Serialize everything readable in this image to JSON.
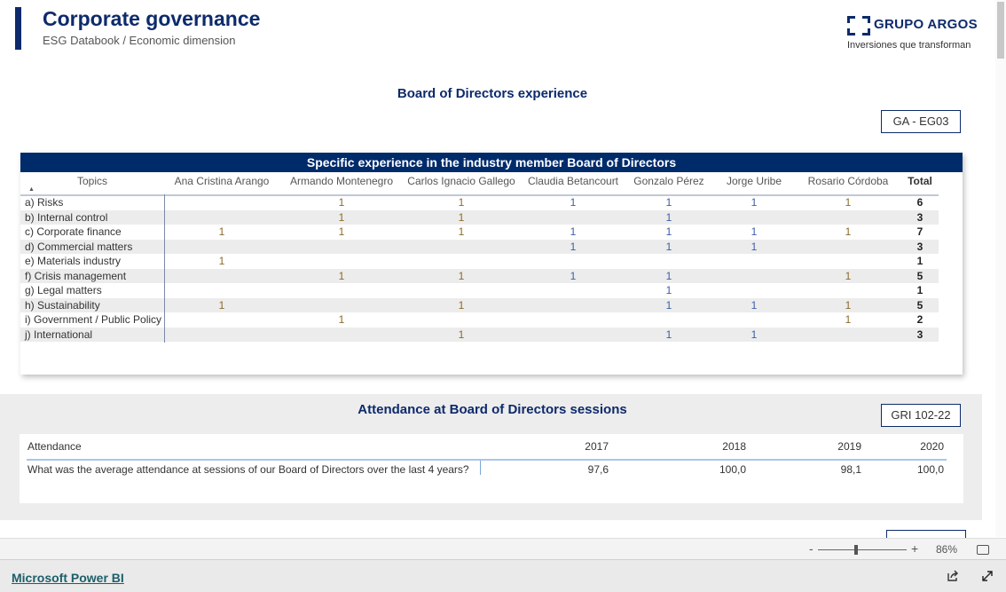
{
  "header": {
    "title": "Corporate governance",
    "subtitle": "ESG Databook / Economic dimension",
    "logo_brand": "GRUPO ARGOS",
    "logo_tagline": "Inversiones que transforman"
  },
  "colors": {
    "navy": "#0d2a6b",
    "table_header": "#002b6b",
    "value_gold": "#8a6a2a",
    "value_blue": "#3a5ea8"
  },
  "experience": {
    "heading": "Board of Directors experience",
    "code": "GA - EG03",
    "table_title": "Specific experience in the industry member Board of Directors",
    "topics_header": "Topics",
    "total_header": "Total",
    "members": [
      "Ana Cristina Arango",
      "Armando Montenegro",
      "Carlos Ignacio Gallego",
      "Claudia Betancourt",
      "Gonzalo Pérez",
      "Jorge Uribe",
      "Rosario Córdoba"
    ],
    "rows": [
      {
        "topic": "a) Risks",
        "values": [
          "",
          "1",
          "1",
          "1",
          "1",
          "1",
          "1"
        ],
        "total": "6"
      },
      {
        "topic": "b) Internal control",
        "values": [
          "",
          "1",
          "1",
          "",
          "1",
          "",
          ""
        ],
        "total": "3"
      },
      {
        "topic": "c) Corporate finance",
        "values": [
          "1",
          "1",
          "1",
          "1",
          "1",
          "1",
          "1"
        ],
        "total": "7"
      },
      {
        "topic": "d) Commercial matters",
        "values": [
          "",
          "",
          "",
          "1",
          "1",
          "1",
          ""
        ],
        "total": "3"
      },
      {
        "topic": "e) Materials industry",
        "values": [
          "1",
          "",
          "",
          "",
          "",
          "",
          ""
        ],
        "total": "1"
      },
      {
        "topic": "f) Crisis management",
        "values": [
          "",
          "1",
          "1",
          "1",
          "1",
          "",
          "1"
        ],
        "total": "5"
      },
      {
        "topic": "g) Legal matters",
        "values": [
          "",
          "",
          "",
          "",
          "1",
          "",
          ""
        ],
        "total": "1"
      },
      {
        "topic": "h) Sustainability",
        "values": [
          "1",
          "",
          "1",
          "",
          "1",
          "1",
          "1"
        ],
        "total": "5"
      },
      {
        "topic": "i) Government / Public Policy",
        "values": [
          "",
          "1",
          "",
          "",
          "",
          "",
          "1"
        ],
        "total": "2"
      },
      {
        "topic": "j) International",
        "values": [
          "",
          "",
          "1",
          "",
          "1",
          "1",
          ""
        ],
        "total": "3"
      }
    ]
  },
  "attendance": {
    "heading": "Attendance at Board of Directors sessions",
    "code": "GRI 102-22",
    "label_header": "Attendance",
    "years": [
      "2017",
      "2018",
      "2019",
      "2020"
    ],
    "question": "What was the average attendance at sessions of our Board of Directors over the last 4 years?",
    "values": [
      "97,6",
      "100,0",
      "98,1",
      "100,0"
    ]
  },
  "zoom": {
    "minus": "-",
    "plus": "+",
    "level_percent": 86,
    "level_label": "86%"
  },
  "footer": {
    "link": "Microsoft Power BI"
  }
}
